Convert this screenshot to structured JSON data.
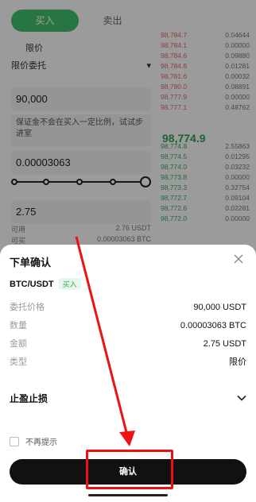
{
  "trade": {
    "tab_buy": "买入",
    "tab_sell": "卖出",
    "order_type_top": "限价",
    "order_type_label": "限价委托",
    "price_value": "90,000",
    "hint": "保证金不会在买入一定比例，试试步进室",
    "amount_value": "0.00003063",
    "total_value": "2.75",
    "available": [
      {
        "label": "可用",
        "value": "2.76 USDT"
      },
      {
        "label": "可买",
        "value": "0.00003063 BTC"
      }
    ]
  },
  "orderbook": {
    "asks": [
      {
        "price": "98,784.7",
        "qty": "0.04644"
      },
      {
        "price": "98,784.1",
        "qty": "0.00000"
      },
      {
        "price": "98,784.6",
        "qty": "0.09880"
      },
      {
        "price": "98,784.8",
        "qty": "0.01281"
      },
      {
        "price": "98,781.6",
        "qty": "0.00032"
      },
      {
        "price": "98,780.0",
        "qty": "0.08891"
      },
      {
        "price": "98,777.9",
        "qty": "0.00000"
      },
      {
        "price": "98,777.1",
        "qty": "0.48762"
      }
    ],
    "mid": "98,774.9",
    "bids": [
      {
        "price": "98,774.8",
        "qty": "2.55863"
      },
      {
        "price": "98,774.5",
        "qty": "0.01295"
      },
      {
        "price": "98,774.0",
        "qty": "0.03232"
      },
      {
        "price": "98,773.8",
        "qty": "0.00000"
      },
      {
        "price": "98,773.3",
        "qty": "0.32754"
      },
      {
        "price": "98,772.7",
        "qty": "0.09104"
      },
      {
        "price": "98,772.6",
        "qty": "0.02281"
      },
      {
        "price": "98,772.0",
        "qty": "0.00000"
      }
    ]
  },
  "sheet": {
    "title": "下单确认",
    "pair": "BTC/USDT",
    "side_badge": "买入",
    "details": [
      {
        "label": "委托价格",
        "value": "90,000 USDT"
      },
      {
        "label": "数量",
        "value": "0.00003063 BTC"
      },
      {
        "label": "金额",
        "value": "2.75 USDT"
      },
      {
        "label": "类型",
        "value": "限价"
      }
    ],
    "tpsl_label": "止盈止损",
    "no_remind": "不再提示",
    "confirm": "确认"
  },
  "colors": {
    "buy": "#3fbf6a",
    "ask": "#e26a6a",
    "bid": "#3aa85f",
    "annotation": "#e11111"
  }
}
